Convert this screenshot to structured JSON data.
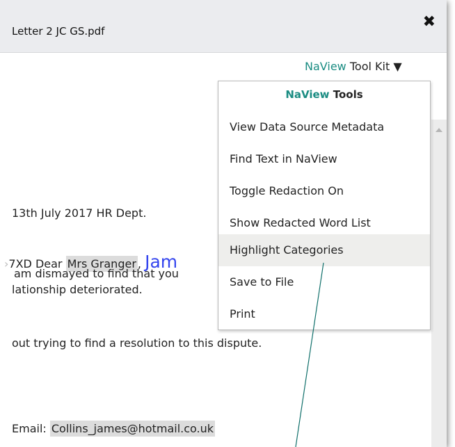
{
  "window": {
    "title": "Letter 2 JC GS.pdf",
    "close_glyph": "✖"
  },
  "toolkit": {
    "brand": "NaView",
    "label": "Tool Kit",
    "caret": "▼"
  },
  "menu": {
    "header_brand": "NaView",
    "header_label": "Tools",
    "items": [
      {
        "label": "View Data Source Metadata"
      },
      {
        "label": "Find Text in NaView"
      },
      {
        "label": "Toggle Redaction On"
      },
      {
        "label": "Show Redacted Word List"
      },
      {
        "label": "Highlight Categories"
      },
      {
        "label": "Save to File"
      },
      {
        "label": "Print"
      }
    ],
    "active_item": "Highlight Categories"
  },
  "document": {
    "date_line": "13th July 2017 HR Dept.",
    "fragment_prefix": "7XD Dear ",
    "recipient": "Mrs Granger",
    "comma": ",",
    "big_name": "Jam",
    "line2": "am dismayed to find that you",
    "line3": "lationship deteriorated.",
    "line4": "out trying to find a resolution to this dispute.",
    "email_label": "Email: ",
    "email_value": "Collins_james@hotmail.co.uk"
  },
  "colors": {
    "brand": "#1a8c82",
    "highlight": "#dcdcdc",
    "big_name": "#3344ee"
  }
}
